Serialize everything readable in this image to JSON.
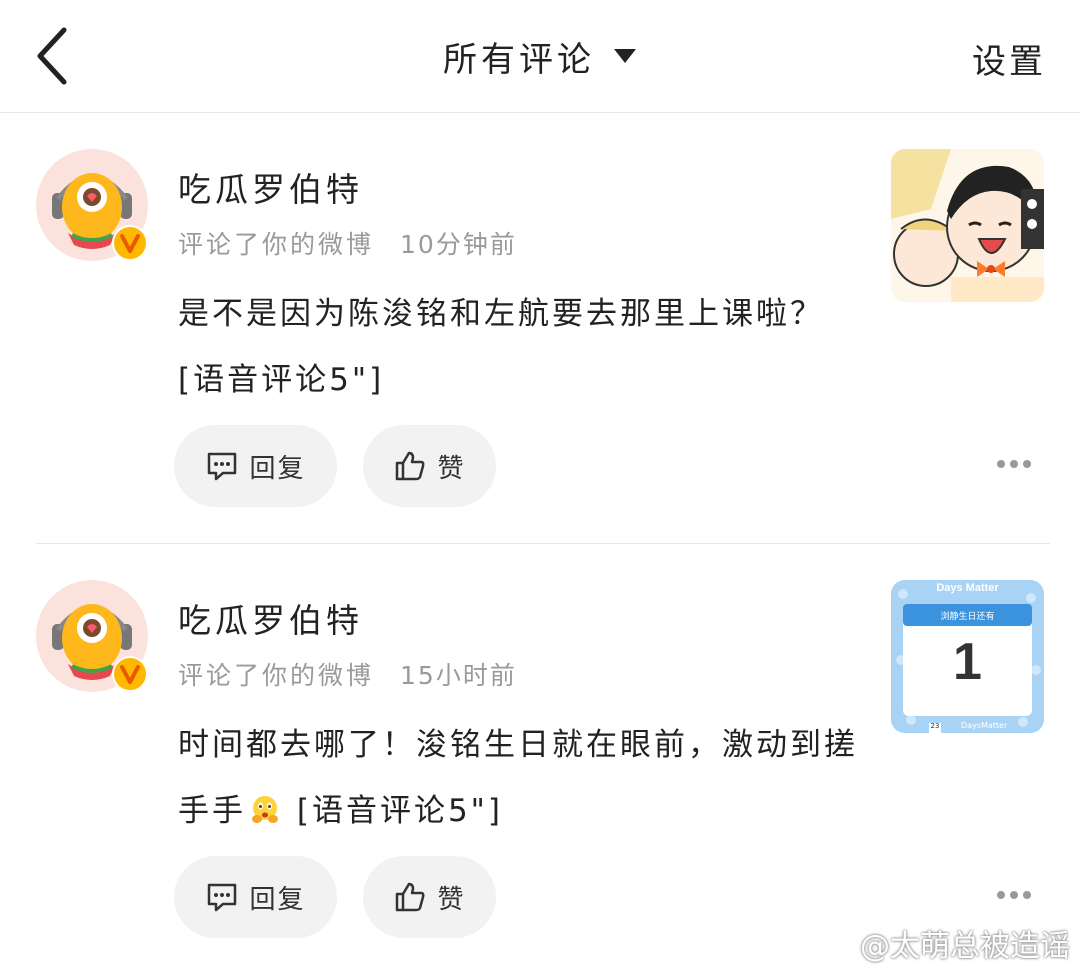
{
  "header": {
    "title": "所有评论",
    "settings_label": "设置"
  },
  "comments": [
    {
      "username": "吃瓜罗伯特",
      "action": "评论了你的微博",
      "time": "10分钟前",
      "text": "是不是因为陈浚铭和左航要去那里上课啦？ [语音评论5\"]",
      "reply_label": "回复",
      "like_label": "赞"
    },
    {
      "username": "吃瓜罗伯特",
      "action": "评论了你的微博",
      "time": "15小时前",
      "text_before_emoji": "时间都去哪了！浚铭生日就在眼前，激动到搓手手",
      "text_after_emoji": " [语音评论5\"]",
      "reply_label": "回复",
      "like_label": "赞",
      "thumb_title": "Days Matter",
      "thumb_banner": "浏静生日还有",
      "thumb_number": "1",
      "thumb_footer": "DaysMatter",
      "thumb_date_badge": "23"
    }
  ],
  "watermark": "@太萌总被造谣",
  "colors": {
    "accent_orange": "#ff8a00",
    "badge_gold": "#ffb800",
    "pill_bg": "#f2f2f2",
    "meta_gray": "#9a9a9a"
  },
  "icons": [
    "back-arrow-icon",
    "caret-down-icon",
    "comment-icon",
    "thumbs-up-icon",
    "more-icon",
    "verified-v-icon",
    "weibo-logo-icon"
  ]
}
